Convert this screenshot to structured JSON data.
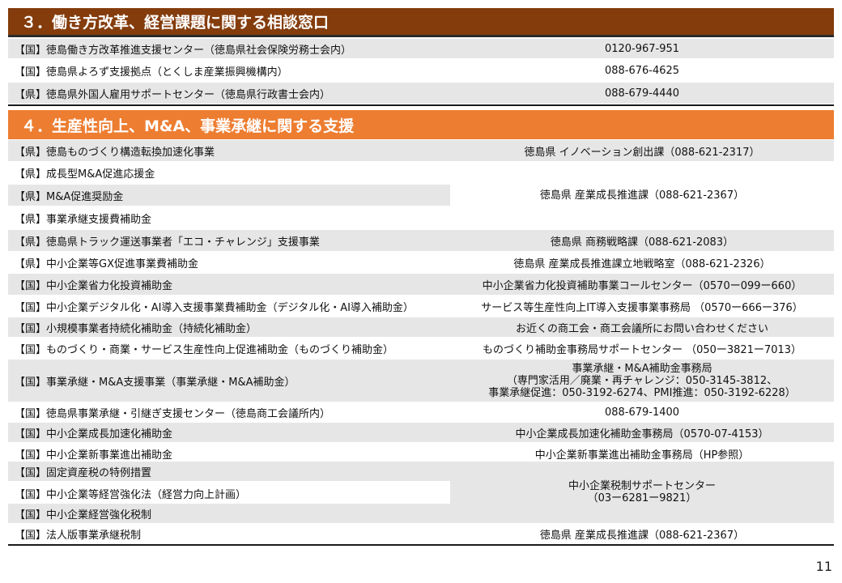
{
  "section3": {
    "title": "３．働き方改革、経営課題に関する相談窓口",
    "rows": [
      {
        "name": "【国】徳島働き方改革推進支援センター（徳島県社会保険労務士会内）",
        "contact": "0120-967-951"
      },
      {
        "name": "【国】徳島県よろず支援拠点（とくしま産業振興機構内）",
        "contact": "088-676-4625"
      },
      {
        "name": "【県】徳島県外国人雇用サポートセンター（徳島県行政書士会内）",
        "contact": "088-679-4440"
      }
    ]
  },
  "section4": {
    "title": "４．生産性向上、M&A、事業承継に関する支援",
    "rows": [
      {
        "name": "【県】徳島ものづくり構造転換加速化事業",
        "contact": "徳島県 イノベーション創出課（088-621-2317）"
      },
      {
        "name": "【県】成長型M&A促進応援金"
      },
      {
        "name": "【県】M&A促進奨励金"
      },
      {
        "name": "【県】事業承継支援費補助金"
      },
      {
        "name": "【県】徳島県トラック運送事業者「エコ・チャレンジ」支援事業",
        "contact": "徳島県 商務戦略課（088-621-2083）"
      },
      {
        "name": "【県】中小企業等GX促進事業費補助金",
        "contact": "徳島県 産業成長推進課立地戦略室（088-621-2326）"
      },
      {
        "name": "【国】中小企業省力化投資補助金",
        "contact": "中小企業省力化投資補助事業コールセンター（0570ー099ー660）"
      },
      {
        "name": "【国】中小企業デジタル化・AI導入支援事業費補助金（デジタル化・AI導入補助金）",
        "contact": "サービス等生産性向上IT導入支援事業事務局 （0570ー666ー376）"
      },
      {
        "name": "【国】小規模事業者持続化補助金（持続化補助金）",
        "contact": "お近くの商工会・商工会議所にお問い合わせください"
      },
      {
        "name": "【国】ものづくり・商業・サービス生産性向上促進補助金（ものづくり補助金）",
        "contact": "ものづくり補助金事務局サポートセンター （050ー3821ー7013）"
      },
      {
        "name": "【国】事業承継・M&A支援事業（事業承継・M&A補助金）"
      },
      {
        "name": "【国】徳島県事業承継・引継ぎ支援センター（徳島商工会議所内）",
        "contact": "088-679-1400"
      },
      {
        "name": "【国】中小企業成長加速化補助金",
        "contact": "中小企業成長加速化補助金事務局（0570-07-4153）"
      },
      {
        "name": "【国】中小企業新事業進出補助金",
        "contact": "中小企業新事業進出補助金事務局（HP参照）"
      },
      {
        "name": "【国】固定資産税の特例措置"
      },
      {
        "name": "【国】中小企業等経営強化法（経営力向上計画）"
      },
      {
        "name": "【国】中小企業経営強化税制"
      },
      {
        "name": "【国】法人版事業承継税制",
        "contact": "徳島県 産業成長推進課（088-621-2367）"
      }
    ],
    "merged_contacts": {
      "ma_group": "徳島県 産業成長推進課（088-621-2367）",
      "succession_line1": "事業承継・M&A補助金事務局",
      "succession_line2": "（専門家活用／廃業・再チャレンジ：050-3145-3812、",
      "succession_line3": "事業承継促進：050-3192-6274、PMI推進：050-3192-6228）",
      "tax_line1": "中小企業税制サポートセンター",
      "tax_line2": "（03ー6281ー9821）"
    }
  },
  "page_number": "11"
}
